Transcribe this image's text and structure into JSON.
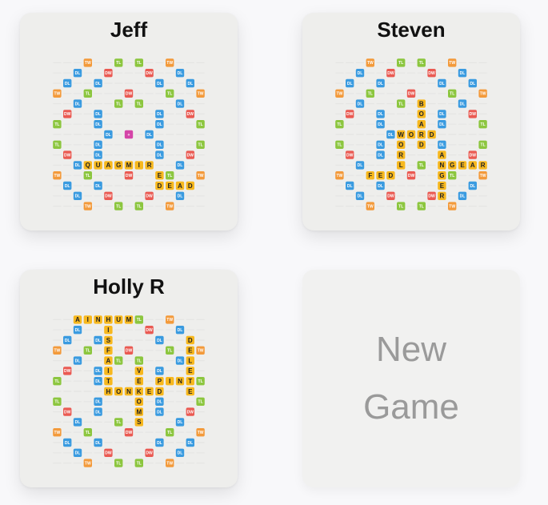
{
  "games": [
    {
      "player": "Jeff",
      "rows": [
        "...............",
        "...............",
        "...............",
        "...............",
        "...............",
        "...............",
        "...............",
        "...............",
        "...............",
        "...............",
        "...QUAGMIR.....",
        "..........E....",
        "..........DEAD.",
        "...............",
        "..............."
      ],
      "star": "+"
    },
    {
      "player": "Steven",
      "rows": [
        "...............",
        "...............",
        "...............",
        "...............",
        "........B......",
        "........O......",
        "........A......",
        "......WORD.....",
        "......O.D......",
        "......R...A....",
        "......L...NGEAR",
        "...FED....G....",
        "..........E....",
        "..........R....",
        "..............."
      ]
    },
    {
      "player": "Holly R",
      "rows": [
        "..AINHUM.......",
        ".....I.........",
        ".....S.......D.",
        ".....F.......E.",
        ".....A.......L.",
        ".....I..V....E.",
        ".....T..E.PINT.",
        ".....HONKED..E.",
        "........O......",
        "........M......",
        "........S......",
        "...............",
        "...............",
        "...............",
        "..............."
      ]
    }
  ],
  "premium_rows": [
    "......TW...TL.TL...TW......",
    "...DL....DW.......DW....DL...",
    "...."
  ],
  "bonus_labels": {
    "TW": "TW",
    "DW": "DW",
    "TL": "TL",
    "DL": "DL"
  },
  "bonus_colors": {
    "TW": "#f39a3b",
    "DW": "#ea5a52",
    "TL": "#8cc63f",
    "DL": "#3a9be0",
    "letter": "#f7b81e",
    "star": "#d544a8",
    "empty": "#e5e5e3"
  },
  "new_game": {
    "line1": "New",
    "line2": "Game"
  }
}
